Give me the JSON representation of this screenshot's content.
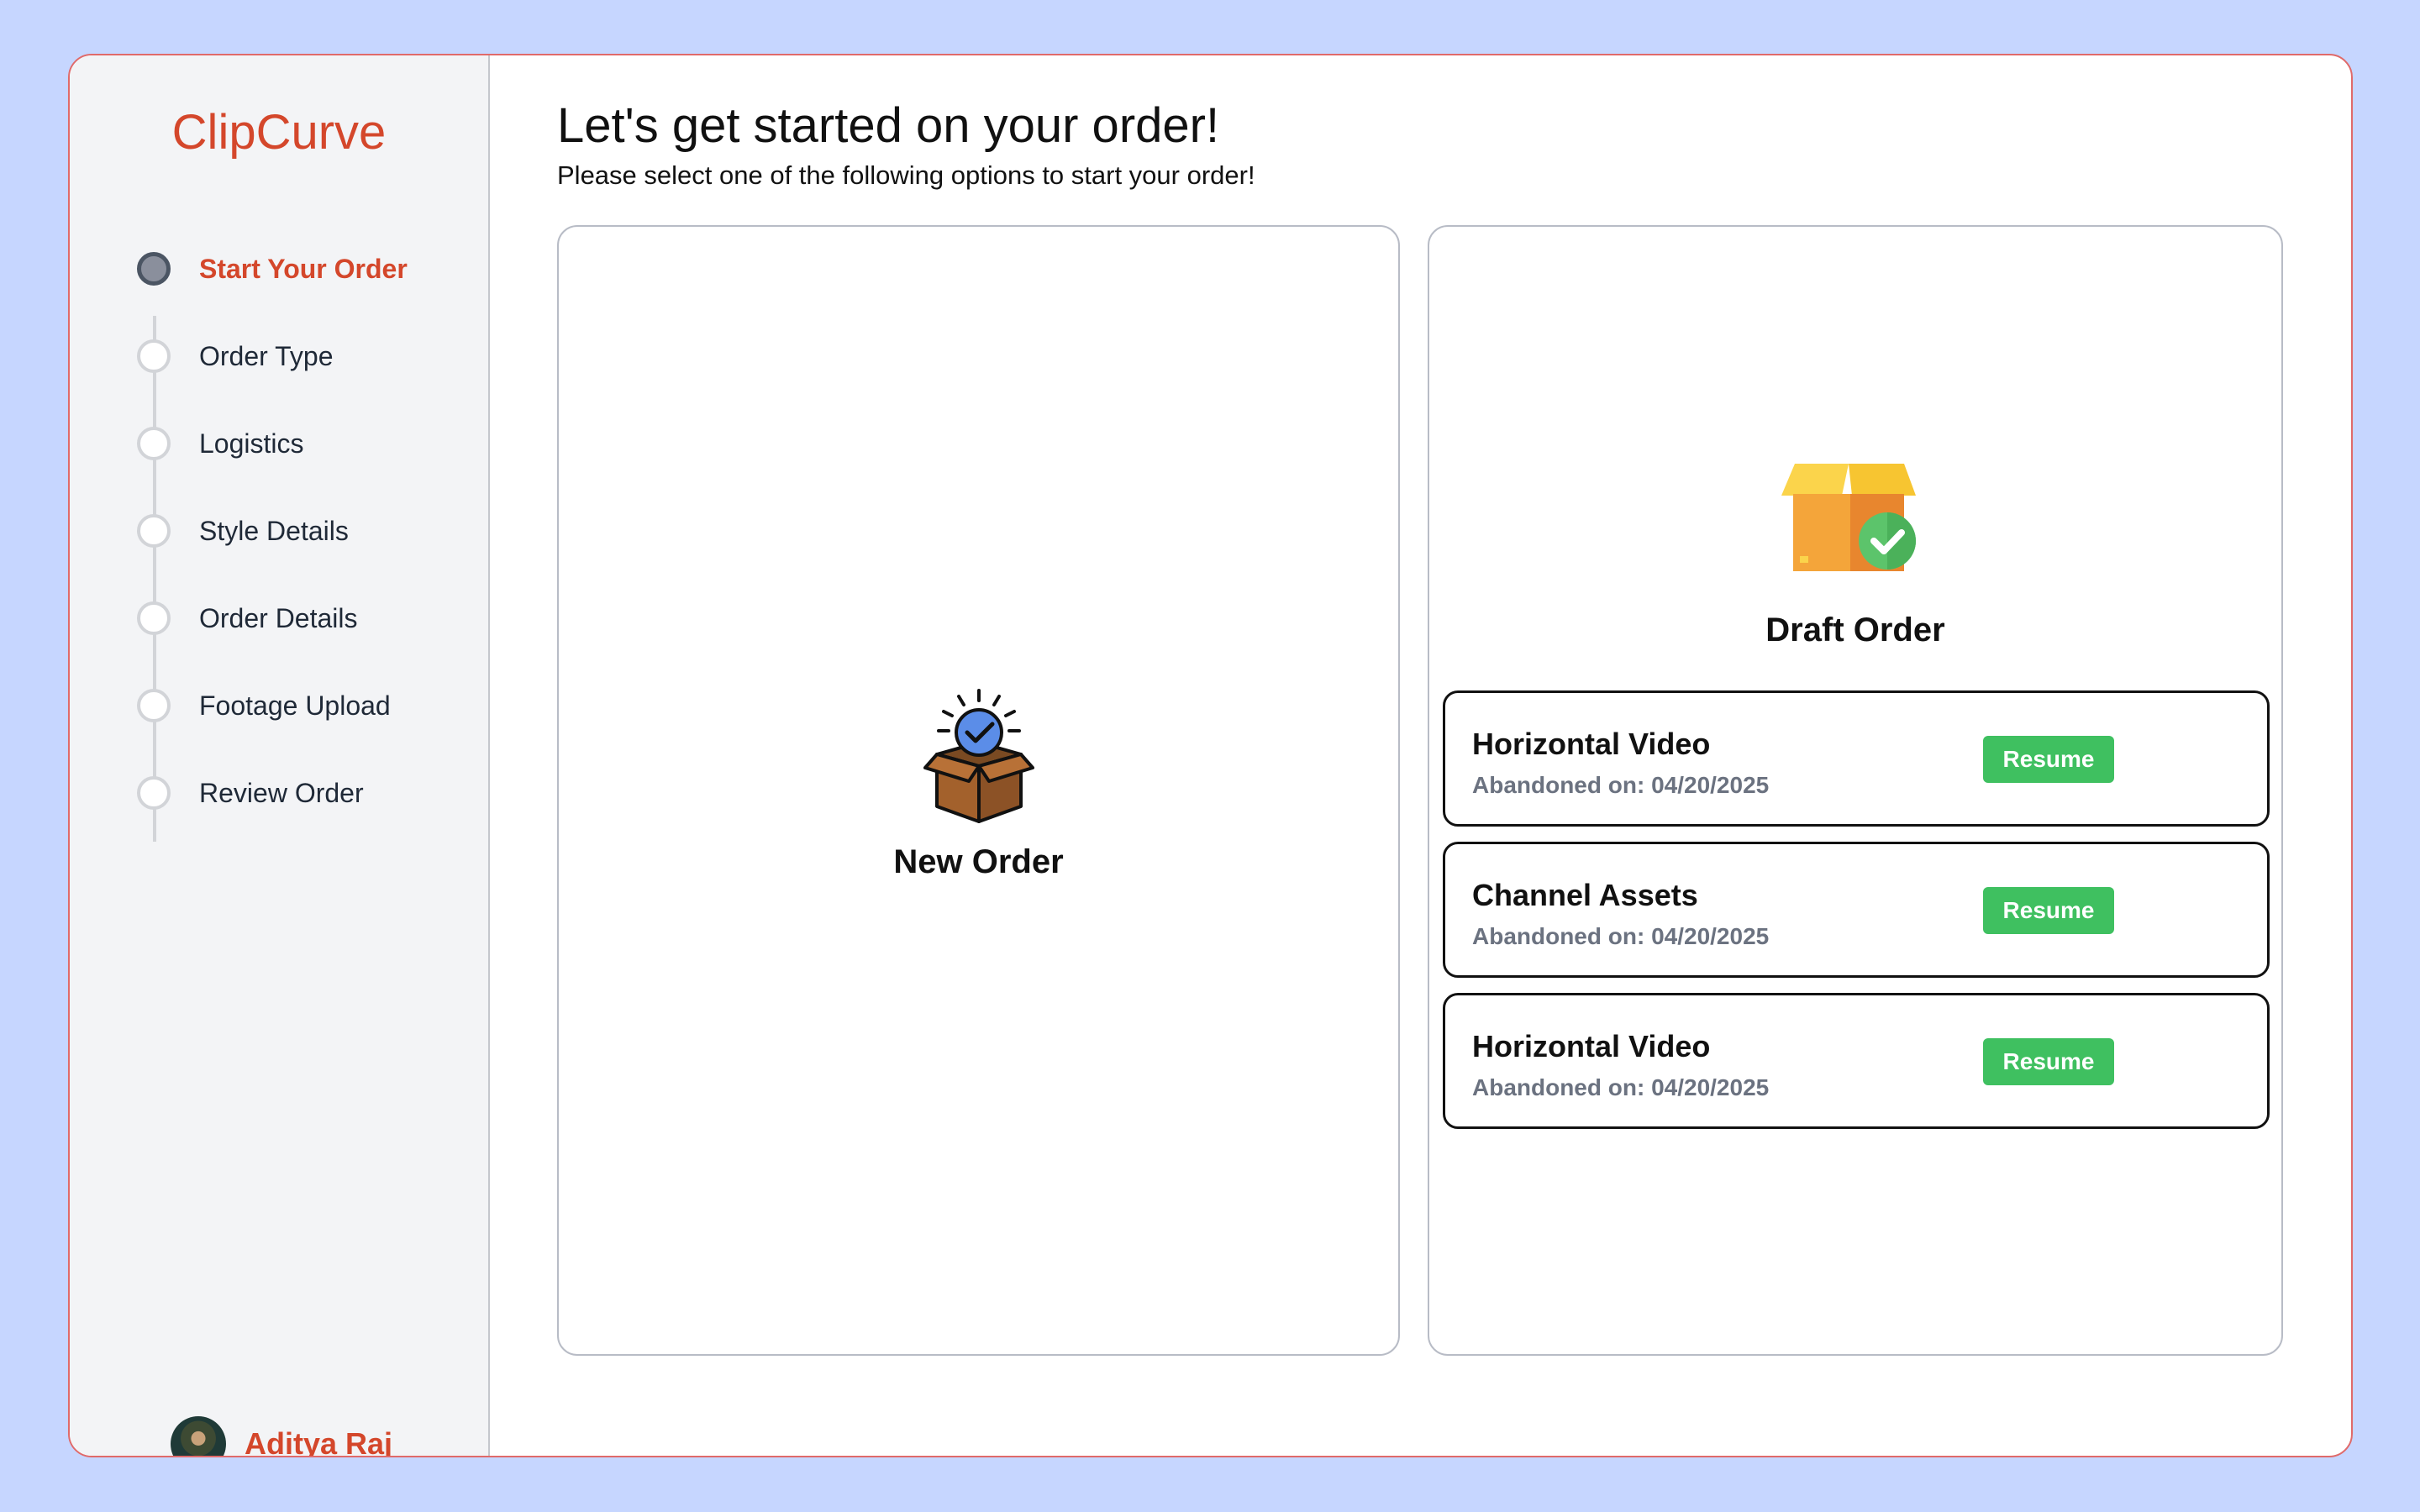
{
  "sidebar": {
    "brand": "ClipCurve",
    "steps": [
      {
        "label": "Start Your Order",
        "active": true
      },
      {
        "label": "Order Type",
        "active": false
      },
      {
        "label": "Logistics",
        "active": false
      },
      {
        "label": "Style Details",
        "active": false
      },
      {
        "label": "Order Details",
        "active": false
      },
      {
        "label": "Footage Upload",
        "active": false
      },
      {
        "label": "Review Order",
        "active": false
      }
    ],
    "user": {
      "name": "Aditya Raj"
    }
  },
  "main": {
    "title": "Let's get started on your order!",
    "subtitle": "Please select one of the following options to start your order!",
    "new_order": {
      "label": "New Order",
      "icon": "open-box-check-icon"
    },
    "draft_order": {
      "label": "Draft Order",
      "icon": "package-check-icon",
      "items": [
        {
          "name": "Horizontal Video",
          "date": "Abandoned on: 04/20/2025",
          "button": "Resume"
        },
        {
          "name": "Channel Assets",
          "date": "Abandoned on: 04/20/2025",
          "button": "Resume"
        },
        {
          "name": "Horizontal Video",
          "date": "Abandoned on: 04/20/2025",
          "button": "Resume"
        }
      ]
    }
  },
  "colors": {
    "background": "#c6d6ff",
    "brand": "#d4472b",
    "resume_button": "#3fc060",
    "frame_border": "#e06a6a"
  }
}
